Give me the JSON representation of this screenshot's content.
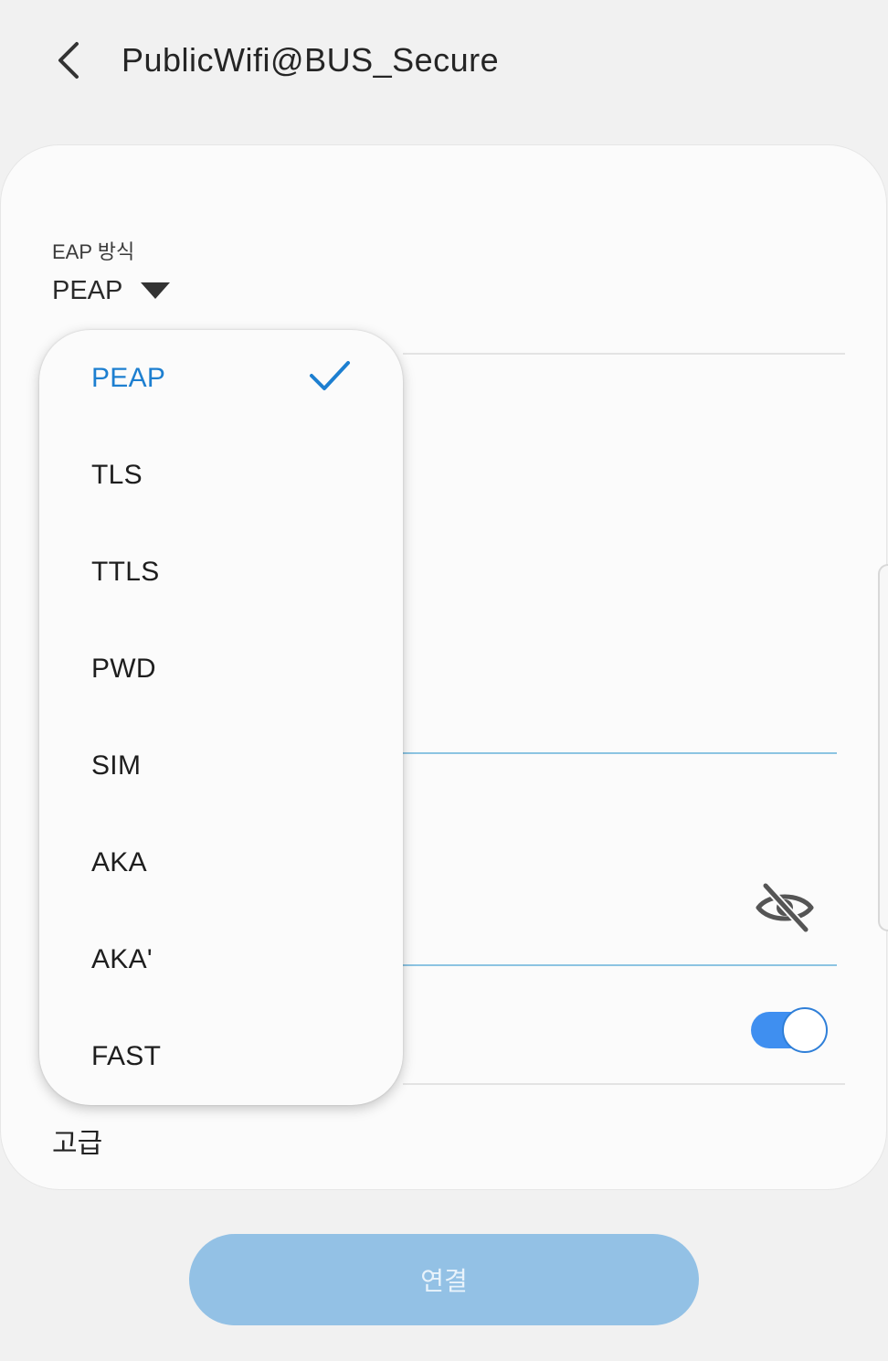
{
  "header": {
    "title": "PublicWifi@BUS_Secure",
    "back_icon": "chevron-left-icon"
  },
  "form": {
    "eap_label": "EAP 방식",
    "eap_value": "PEAP",
    "password_visibility_icon": "eye-off-icon",
    "toggle_on": true,
    "advanced_label": "고급"
  },
  "dropdown": {
    "options": [
      "PEAP",
      "TLS",
      "TTLS",
      "PWD",
      "SIM",
      "AKA",
      "AKA'",
      "FAST"
    ],
    "selected": "PEAP",
    "check_icon": "checkmark-icon"
  },
  "footer": {
    "connect_label": "연결"
  },
  "colors": {
    "accent": "#1d7fd0",
    "toggle": "#3f8ff0",
    "connect_button": "#93c1e5",
    "background": "#f1f1f1",
    "card": "#fbfbfb"
  }
}
